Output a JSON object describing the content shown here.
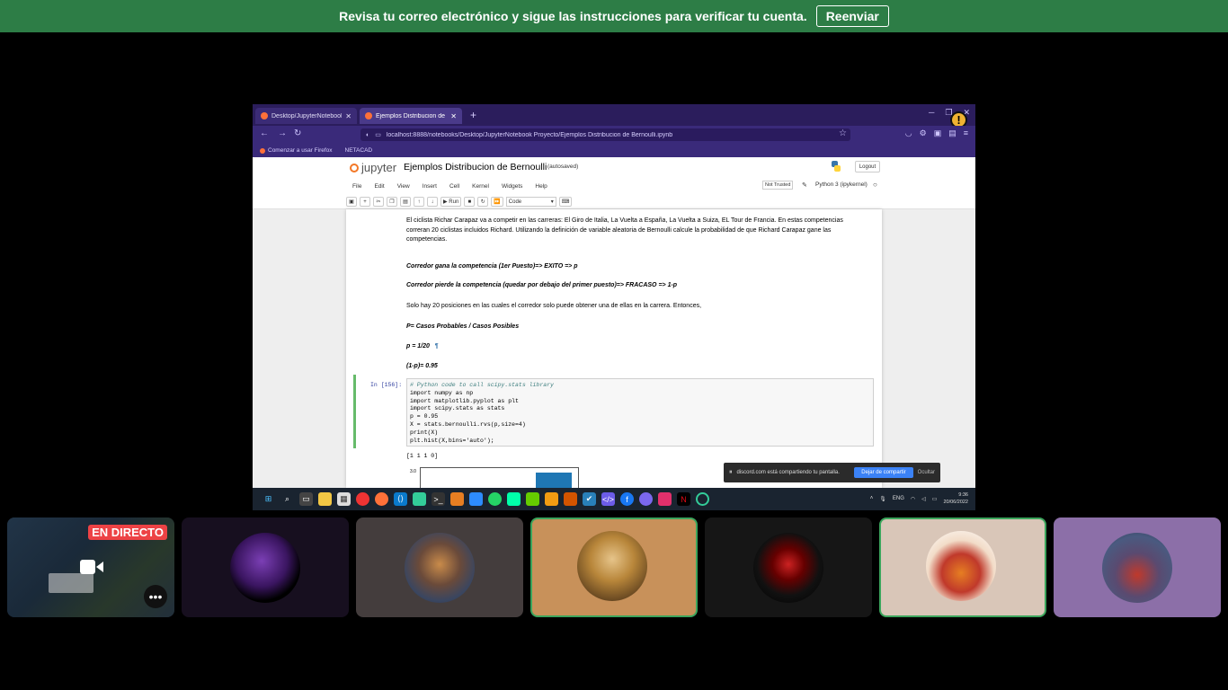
{
  "banner": {
    "message": "Revisa tu correo electrónico y sigue las instrucciones para verificar tu cuenta.",
    "resend_label": "Reenviar"
  },
  "browser": {
    "tabs": [
      {
        "label": "Desktop/JupyterNotebook Proy..."
      },
      {
        "label": "Ejemplos Distribucion de Bern..."
      }
    ],
    "url": "localhost:8888/notebooks/Desktop/JupyterNotebook Proyecto/Ejemplos Distribucion de Bernoulli.ipynb",
    "bookmarks": [
      "Comenzar a usar Firefox",
      "NETACAD"
    ]
  },
  "jupyter": {
    "logo_text": "jupyter",
    "notebook_title": "Ejemplos Distribucion de Bernoulli",
    "save_status": "(autosaved)",
    "logout_label": "Logout",
    "menu": [
      "File",
      "Edit",
      "View",
      "Insert",
      "Cell",
      "Kernel",
      "Widgets",
      "Help"
    ],
    "trusted_label": "Not Trusted",
    "kernel_label": "Python 3 (ipykernel)",
    "run_label": "Run",
    "cell_type": "Code"
  },
  "notebook": {
    "paragraph": [
      "El ciclista Richar Carapaz va a competir en las carreras: El Giro de Italia, La Vuelta a España, La Vuelta a Suiza, EL Tour de Francia. En estas competencias",
      "correran 20 ciclistas incluidos Richard. Utilizando la definición de variable aleatoria de Bernoulli calcule la probabilidad de que Richard Carapaz gane las",
      "competencias."
    ],
    "exito": "Corredor gana la competencia (1er Puesto)=> EXITO => p",
    "fracaso": "Corredor pierde la competencia (quedar por debajo del primer puesto)=> FRACASO => 1-p",
    "posiciones": "Solo hay 20 posiciones en las cuales el corredor solo puede obtener una de ellas en la carrera. Entonces,",
    "formula_p": "P= Casos Probables / Casos Posibles",
    "p_value": "p = 1/20",
    "one_minus_p": "(1-p)= 0.95",
    "cell_prompt": "In [156]:",
    "code_lines": [
      "# Python code to call scipy.stats library",
      "import numpy as np",
      "import matplotlib.pyplot as plt",
      "import scipy.stats as stats",
      "p = 0.95",
      "X = stats.bernoulli.rvs(p,size=4)",
      "print(X)",
      "plt.hist(X,bins='auto');"
    ],
    "output": "[1 1 1 0]",
    "plot_ytick": "3.0"
  },
  "share_notice": {
    "text": "discord.com está compartiendo tu pantalla.",
    "stop_label": "Dejar de compartir",
    "hide_label": "Ocultar"
  },
  "taskbar": {
    "lang": "ENG",
    "time": "9:36",
    "date": "20/06/2022"
  },
  "participants": {
    "live_label": "EN DIRECTO",
    "more_label": "•••"
  }
}
